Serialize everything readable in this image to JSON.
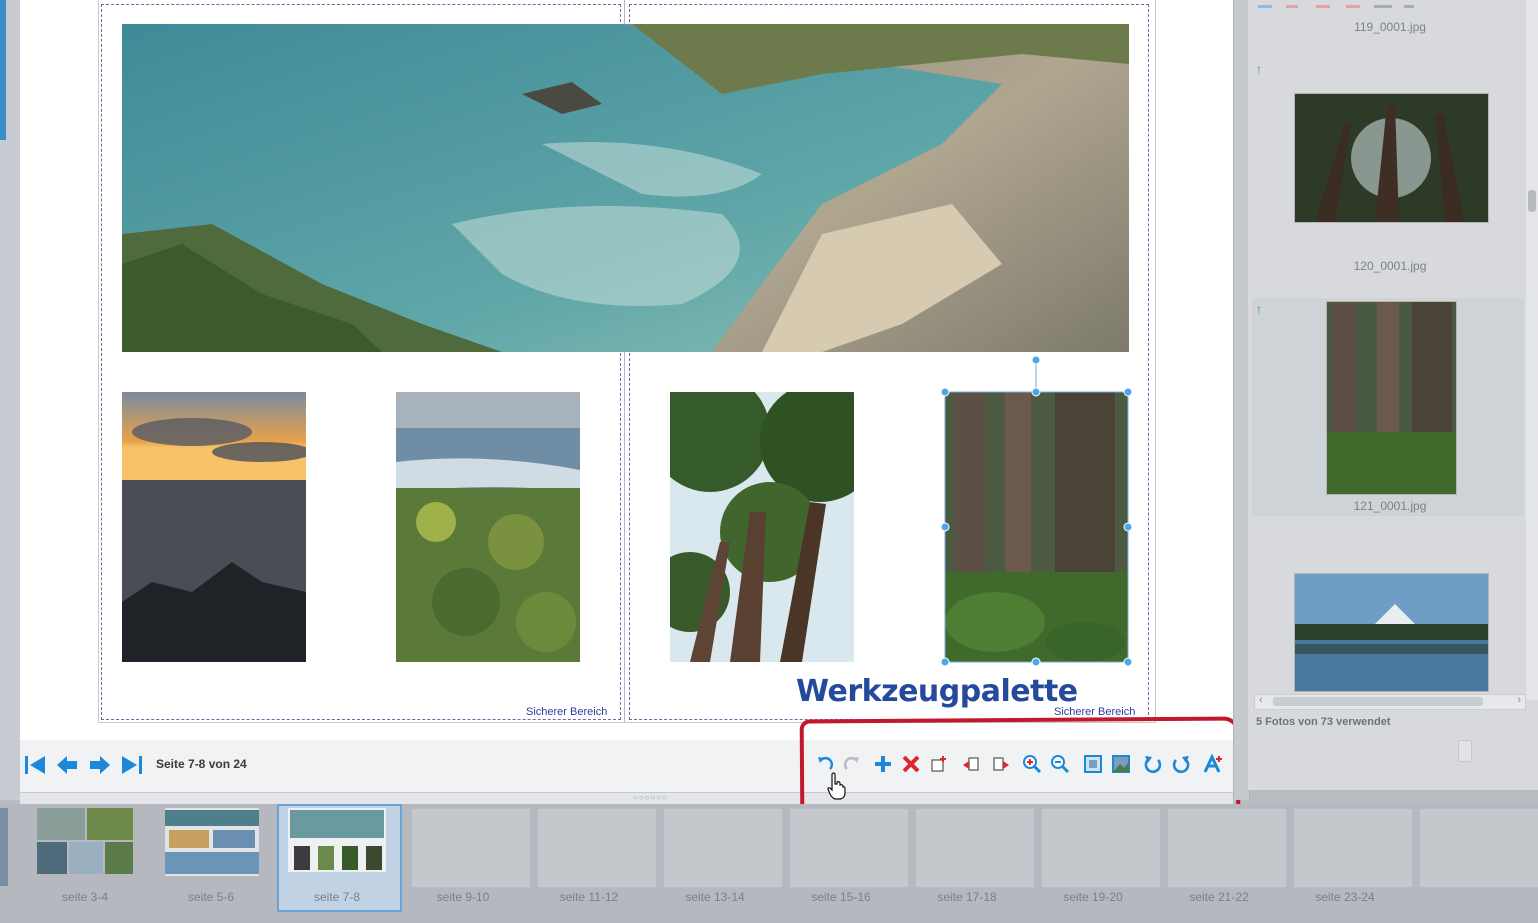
{
  "app": {
    "accent_color": "#1e88d8",
    "annotation_color": "#c0182c"
  },
  "canvas": {
    "safe_area_label_left": "Sicherer Bereich",
    "safe_area_label_right": "Sicherer Bereich",
    "photos": [
      "coastal-panorama",
      "sunset-sea",
      "coast-flowers",
      "redwood-canopy",
      "redwood-trunk-selected"
    ]
  },
  "annotation": {
    "title": "Werkzeugpalette"
  },
  "navigation": {
    "page_indicator": "Seite 7-8 von 24",
    "buttons": [
      "first-page-icon",
      "previous-page-icon",
      "next-page-icon",
      "last-page-icon"
    ]
  },
  "toolbar": {
    "tools": [
      "undo-icon",
      "redo-icon",
      "add-icon",
      "delete-icon",
      "new-frame-icon",
      "move-to-back-icon",
      "move-to-front-icon",
      "zoom-in-icon",
      "zoom-out-icon",
      "fit-image-icon",
      "fill-frame-icon",
      "rotate-left-icon",
      "rotate-right-icon",
      "add-text-icon"
    ]
  },
  "library": {
    "items": [
      {
        "label": "119_0001.jpg"
      },
      {
        "label": "120_0001.jpg"
      },
      {
        "label": "121_0001.jpg"
      }
    ],
    "usage_text": "5 Fotos von 73 verwendet"
  },
  "filmstrip": {
    "spreads": [
      {
        "label": "seite 3-4"
      },
      {
        "label": "seite 5-6"
      },
      {
        "label": "seite 7-8"
      },
      {
        "label": "seite 9-10"
      },
      {
        "label": "seite 11-12"
      },
      {
        "label": "seite 13-14"
      },
      {
        "label": "seite 15-16"
      },
      {
        "label": "seite 17-18"
      },
      {
        "label": "seite 19-20"
      },
      {
        "label": "seite 21-22"
      },
      {
        "label": "seite 23-24"
      }
    ],
    "selected_index": 2
  }
}
